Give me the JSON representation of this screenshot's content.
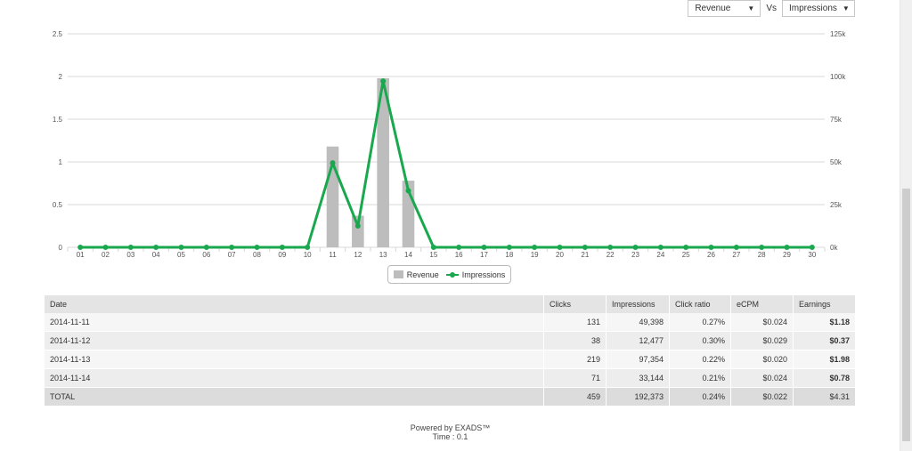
{
  "controls": {
    "metric_left": "Revenue",
    "vs": "Vs",
    "metric_right": "Impressions"
  },
  "colors": {
    "bar": "#bdbdbd",
    "line": "#1aa84f",
    "grid": "#d8d8d8"
  },
  "chart_data": {
    "type": "bar",
    "categories": [
      "01",
      "02",
      "03",
      "04",
      "05",
      "06",
      "07",
      "08",
      "09",
      "10",
      "11",
      "12",
      "13",
      "14",
      "15",
      "16",
      "17",
      "18",
      "19",
      "20",
      "21",
      "22",
      "23",
      "24",
      "25",
      "26",
      "27",
      "28",
      "29",
      "30"
    ],
    "series": [
      {
        "name": "Revenue",
        "type": "bar",
        "axis": "left",
        "values": [
          0,
          0,
          0,
          0,
          0,
          0,
          0,
          0,
          0,
          0,
          1.18,
          0.37,
          1.98,
          0.78,
          0,
          0,
          0,
          0,
          0,
          0,
          0,
          0,
          0,
          0,
          0,
          0,
          0,
          0,
          0,
          0
        ]
      },
      {
        "name": "Impressions",
        "type": "line",
        "axis": "right",
        "values": [
          0,
          0,
          0,
          0,
          0,
          0,
          0,
          0,
          0,
          0,
          49398,
          12477,
          97354,
          33144,
          0,
          0,
          0,
          0,
          0,
          0,
          0,
          0,
          0,
          0,
          0,
          0,
          0,
          0,
          0,
          0
        ]
      }
    ],
    "left_axis": {
      "ticks": [
        0,
        0.5,
        1,
        1.5,
        2,
        2.5
      ],
      "tick_labels": [
        "0",
        "0.5",
        "1",
        "1.5",
        "2",
        "2.5"
      ],
      "ylim": [
        0,
        2.5
      ]
    },
    "right_axis": {
      "ticks": [
        0,
        25000,
        50000,
        75000,
        100000,
        125000
      ],
      "tick_labels": [
        "0k",
        "25k",
        "50k",
        "75k",
        "100k",
        "125k"
      ],
      "ylim": [
        0,
        125000
      ]
    },
    "grid": true,
    "legend": "bottom-center"
  },
  "legend": {
    "revenue": "Revenue",
    "impressions": "Impressions"
  },
  "table": {
    "headers": {
      "date": "Date",
      "clicks": "Clicks",
      "impressions": "Impressions",
      "click_ratio": "Click ratio",
      "ecpm": "eCPM",
      "earnings": "Earnings"
    },
    "rows": [
      {
        "date": "2014-11-11",
        "clicks": "131",
        "impressions": "49,398",
        "click_ratio": "0.27%",
        "ecpm": "$0.024",
        "earnings": "$1.18"
      },
      {
        "date": "2014-11-12",
        "clicks": "38",
        "impressions": "12,477",
        "click_ratio": "0.30%",
        "ecpm": "$0.029",
        "earnings": "$0.37"
      },
      {
        "date": "2014-11-13",
        "clicks": "219",
        "impressions": "97,354",
        "click_ratio": "0.22%",
        "ecpm": "$0.020",
        "earnings": "$1.98"
      },
      {
        "date": "2014-11-14",
        "clicks": "71",
        "impressions": "33,144",
        "click_ratio": "0.21%",
        "ecpm": "$0.024",
        "earnings": "$0.78"
      }
    ],
    "total": {
      "date": "TOTAL",
      "clicks": "459",
      "impressions": "192,373",
      "click_ratio": "0.24%",
      "ecpm": "$0.022",
      "earnings": "$4.31"
    }
  },
  "footer": {
    "powered": "Powered by EXADS™",
    "time": "Time : 0.1"
  }
}
